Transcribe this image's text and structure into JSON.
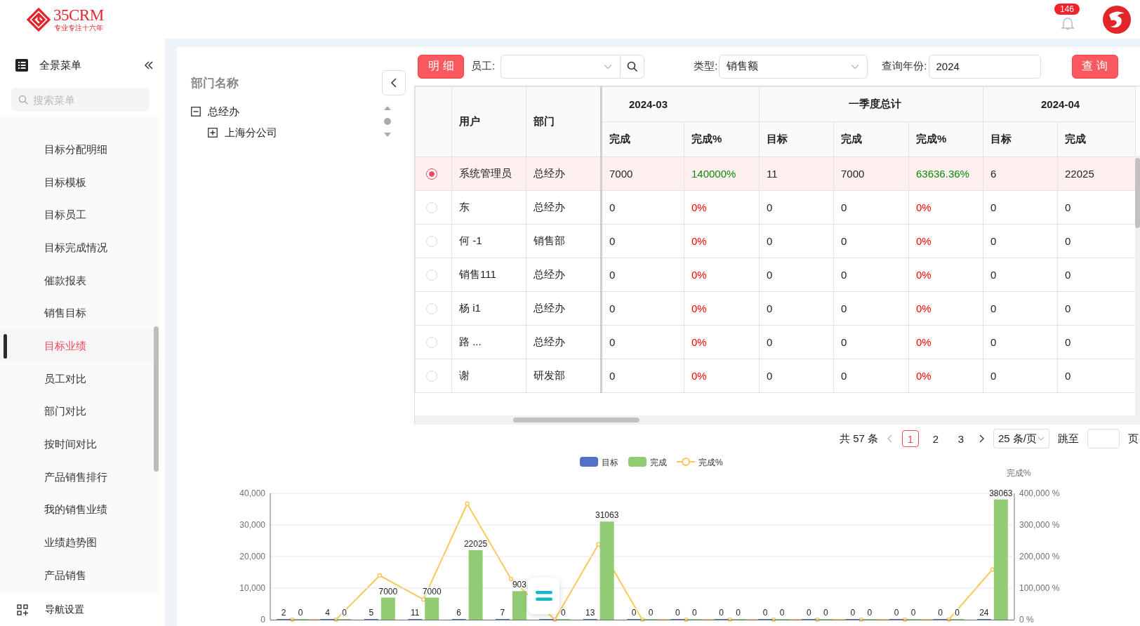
{
  "header": {
    "logo": {
      "name": "35CRM",
      "tagline": "专业专注十六年"
    },
    "notifications": {
      "count": "146"
    }
  },
  "sidebar": {
    "title": "全景菜单",
    "search": {
      "placeholder": "搜索菜单"
    },
    "items": [
      {
        "label": "目标分配明细",
        "selected": false
      },
      {
        "label": "目标模板",
        "selected": false
      },
      {
        "label": "目标员工",
        "selected": false
      },
      {
        "label": "目标完成情况",
        "selected": false
      },
      {
        "label": "催款报表",
        "selected": false
      },
      {
        "label": "销售目标",
        "selected": false
      },
      {
        "label": "目标业绩",
        "selected": true
      },
      {
        "label": "员工对比",
        "selected": false
      },
      {
        "label": "部门对比",
        "selected": false
      },
      {
        "label": "按时间对比",
        "selected": false
      },
      {
        "label": "产品销售排行",
        "selected": false
      },
      {
        "label": "我的销售业绩",
        "selected": false
      },
      {
        "label": "业绩趋势图",
        "selected": false
      },
      {
        "label": "产品销售",
        "selected": false
      }
    ],
    "footer": "导航设置"
  },
  "dept_panel": {
    "title": "部门名称",
    "tree": [
      {
        "label": "总经办",
        "expanded": true,
        "children": [
          {
            "label": "上海分公司",
            "expanded": false
          }
        ]
      }
    ]
  },
  "filters": {
    "detail_button": "明细",
    "employee": {
      "label": "员工:"
    },
    "type": {
      "label": "类型:",
      "value": "销售额"
    },
    "year": {
      "label": "查询年份:",
      "value": "2024"
    },
    "query_button": "查询"
  },
  "table": {
    "fixed_columns": [
      "用户",
      "部门"
    ],
    "column_groups": [
      {
        "title": "2024-03",
        "columns": [
          "完成",
          "完成%"
        ]
      },
      {
        "title": "一季度总计",
        "columns": [
          "目标",
          "完成",
          "完成%"
        ]
      },
      {
        "title": "2024-04",
        "columns": [
          "目标",
          "完成"
        ]
      }
    ],
    "rows": [
      {
        "selected": true,
        "user": "系统管理员",
        "dept": "总经办",
        "cells": [
          {
            "text": "7000"
          },
          {
            "text": "140000%",
            "color": "#0a8a0a"
          },
          {
            "text": "11"
          },
          {
            "text": "7000"
          },
          {
            "text": "63636.36%",
            "color": "#0a8a0a"
          },
          {
            "text": "6"
          },
          {
            "text": "22025"
          }
        ]
      },
      {
        "selected": false,
        "user": "东",
        "dept": "总经办",
        "cells": [
          {
            "text": "0"
          },
          {
            "text": "0%",
            "color": "#ff0000"
          },
          {
            "text": "0"
          },
          {
            "text": "0"
          },
          {
            "text": "0%",
            "color": "#ff0000"
          },
          {
            "text": "0"
          },
          {
            "text": "0"
          }
        ]
      },
      {
        "selected": false,
        "user": "何 -1",
        "dept": "销售部",
        "cells": [
          {
            "text": "0"
          },
          {
            "text": "0%",
            "color": "#ff0000"
          },
          {
            "text": "0"
          },
          {
            "text": "0"
          },
          {
            "text": "0%",
            "color": "#ff0000"
          },
          {
            "text": "0"
          },
          {
            "text": "0"
          }
        ]
      },
      {
        "selected": false,
        "user": "销售111",
        "dept": "总经办",
        "cells": [
          {
            "text": "0"
          },
          {
            "text": "0%",
            "color": "#ff0000"
          },
          {
            "text": "0"
          },
          {
            "text": "0"
          },
          {
            "text": "0%",
            "color": "#ff0000"
          },
          {
            "text": "0"
          },
          {
            "text": "0"
          }
        ]
      },
      {
        "selected": false,
        "user": "杨 i1",
        "dept": "总经办",
        "cells": [
          {
            "text": "0"
          },
          {
            "text": "0%",
            "color": "#ff0000"
          },
          {
            "text": "0"
          },
          {
            "text": "0"
          },
          {
            "text": "0%",
            "color": "#ff0000"
          },
          {
            "text": "0"
          },
          {
            "text": "0"
          }
        ]
      },
      {
        "selected": false,
        "user": "路 ...",
        "dept": "总经办",
        "cells": [
          {
            "text": "0"
          },
          {
            "text": "0%",
            "color": "#ff0000"
          },
          {
            "text": "0"
          },
          {
            "text": "0"
          },
          {
            "text": "0%",
            "color": "#ff0000"
          },
          {
            "text": "0"
          },
          {
            "text": "0"
          }
        ]
      },
      {
        "selected": false,
        "user": "谢",
        "dept": "研发部",
        "cells": [
          {
            "text": "0"
          },
          {
            "text": "0%",
            "color": "#ff0000"
          },
          {
            "text": "0"
          },
          {
            "text": "0"
          },
          {
            "text": "0%",
            "color": "#ff0000"
          },
          {
            "text": "0"
          },
          {
            "text": "0"
          }
        ]
      }
    ]
  },
  "pager": {
    "total": "共 57 条",
    "pages": [
      {
        "label": "1",
        "selected": true
      },
      {
        "label": "2",
        "selected": false
      },
      {
        "label": "3",
        "selected": false
      }
    ],
    "page_size": "25 条/页",
    "jump_label": "跳至",
    "jump_suffix": "页"
  },
  "chart": {
    "bar_chart": {
      "chart_data": {
        "type": "bar",
        "grid": true,
        "legend": "top",
        "ylim": [
          0,
          40000
        ],
        "value_labels": [
          [
            "2",
            "4",
            "5",
            "11",
            "6",
            "7",
            null,
            "13",
            "0",
            "0",
            "0",
            "0",
            "0",
            "0",
            "0",
            "0",
            "24"
          ],
          [
            "0",
            "0",
            "7000",
            "7000",
            "22025",
            "903",
            "0",
            "31063",
            "0",
            "0",
            "0",
            "0",
            "0",
            "0",
            "0",
            "0",
            "38063"
          ]
        ],
        "yticks": [
          0,
          {
            "value": 10000,
            "label": "10,000"
          },
          {
            "value": 20000,
            "label": "20,000"
          },
          {
            "value": 30000,
            "label": "30,000"
          },
          {
            "value": 40000,
            "label": "40,000"
          }
        ],
        "series": [
          {
            "name": "目标",
            "color": "#5470c6",
            "values": [
              2,
              4,
              5,
              11,
              6,
              7,
              0,
              13,
              0,
              0,
              0,
              0,
              0,
              0,
              0,
              0,
              24
            ]
          },
          {
            "name": "完成",
            "color": "#91cc75",
            "values": [
              0,
              0,
              7000,
              7000,
              22025,
              9038,
              0,
              31063,
              0,
              0,
              0,
              0,
              0,
              0,
              0,
              0,
              38063
            ]
          }
        ]
      }
    },
    "line_chart": {
      "chart_data": {
        "type": "line",
        "legend": "top",
        "ylabel": "完成%",
        "ylim": [
          0,
          400000
        ],
        "yticks": [
          {
            "value": 0,
            "label": "0 %"
          },
          {
            "value": 100000,
            "label": "100,000 %"
          },
          {
            "value": 200000,
            "label": "200,000 %"
          },
          {
            "value": 300000,
            "label": "300,000 %"
          },
          {
            "value": 400000,
            "label": "400,000 %"
          }
        ],
        "series": [
          {
            "name": "完成%",
            "color": "#fac858",
            "marker": "circle",
            "values": [
              0,
              0,
              140000,
              64000,
              367000,
              129000,
              0,
              239000,
              0,
              0,
              0,
              0,
              0,
              0,
              0,
              0,
              159000
            ]
          }
        ]
      }
    }
  }
}
